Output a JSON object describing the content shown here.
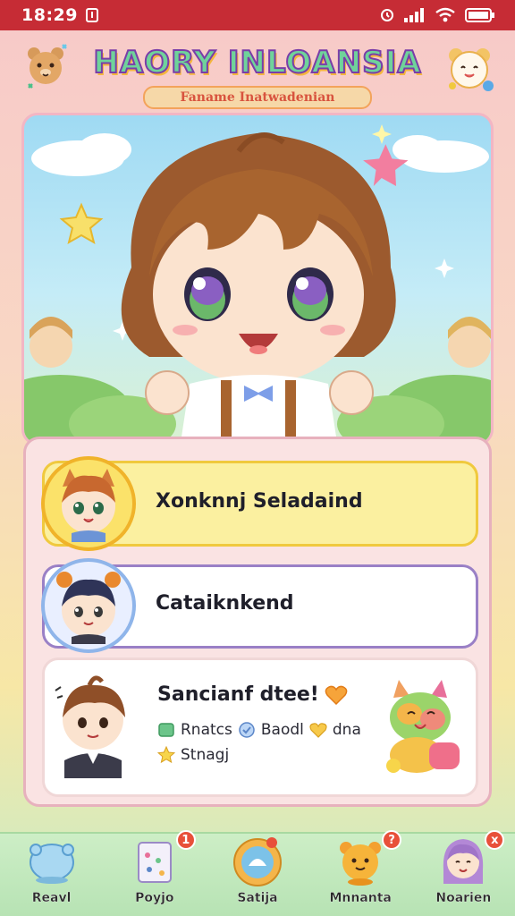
{
  "status_bar": {
    "time": "18:29",
    "icons": [
      "notification-icon",
      "alarm-icon",
      "signal-icon",
      "wifi-icon",
      "battery-icon"
    ]
  },
  "header": {
    "title": "HAORY INLOANSIA",
    "subtitle": "Faname Inatwadenian"
  },
  "list": {
    "items": [
      {
        "label": "Xonknnj Seladaind",
        "avatar": "fox-boy-avatar"
      },
      {
        "label": "Cataiknkend",
        "avatar": "bun-hair-boy-avatar"
      }
    ],
    "feature": {
      "title": "Sancianf dtee!",
      "tags": [
        {
          "icon": "green-gem-icon",
          "label": "Rnatcs"
        },
        {
          "icon": "blue-shield-icon",
          "label": "Baodl"
        },
        {
          "icon": "gold-heart-icon",
          "label": "dna"
        },
        {
          "icon": "gold-star-icon",
          "label": "Stnagj"
        }
      ]
    }
  },
  "nav": {
    "items": [
      {
        "label": "Reavl",
        "icon": "blue-blob-icon",
        "badge": ""
      },
      {
        "label": "Poyjo",
        "icon": "calendar-icon",
        "badge": "1"
      },
      {
        "label": "Satija",
        "icon": "round-pet-icon",
        "badge": ""
      },
      {
        "label": "Mnnanta",
        "icon": "orange-cat-icon",
        "badge": "?"
      },
      {
        "label": "Noarien",
        "icon": "girl-avatar-icon",
        "badge": "x"
      }
    ]
  },
  "colors": {
    "status_bar": "#c62c35",
    "title_fill": "#6fd39a",
    "title_stroke": "#7a3da8",
    "highlight_item": "#fbf0a0",
    "badge": "#e8503a"
  }
}
